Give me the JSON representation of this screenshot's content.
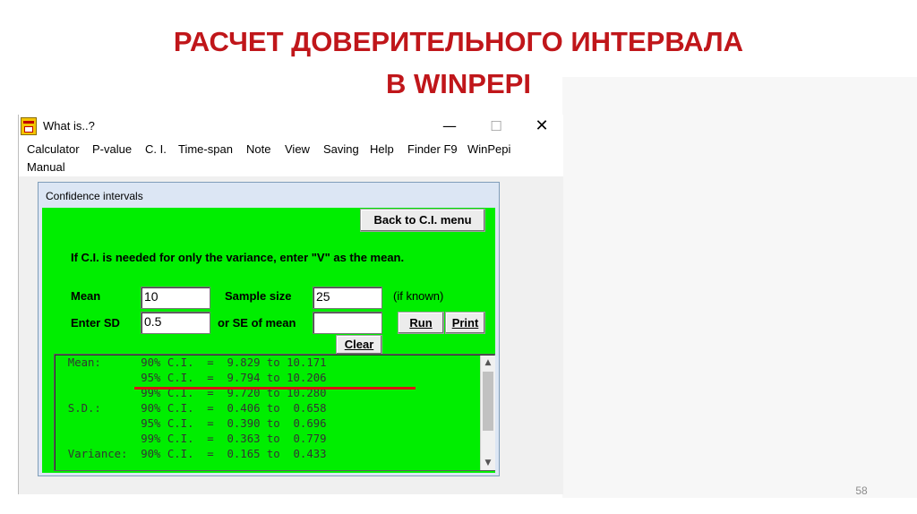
{
  "slide": {
    "title_line1": "РАСЧЕТ ДОВЕРИТЕЛЬНОГО ИНТЕРВАЛА",
    "title_line2": "В WINPEPI",
    "page_number": "58",
    "title_color": "#c0161a"
  },
  "window": {
    "title": "What is..?",
    "minimize_glyph": "—",
    "maximize_glyph": "☐",
    "close_glyph": "✕",
    "icon": "winpepi-app-icon"
  },
  "menu": {
    "items": [
      "Calculator",
      "P-value",
      "C. I.",
      "Time-span",
      "Note",
      "View",
      "Saving",
      "Help",
      "Finder F9",
      "WinPepi"
    ],
    "second_row": [
      "Manual"
    ]
  },
  "panel": {
    "title": "Confidence intervals",
    "back_button": "Back to C.I. menu",
    "instruction": "If C.I. is needed for only the variance, enter \"V\" as the mean.",
    "background_color": "#00ee00"
  },
  "form": {
    "mean_label": "Mean",
    "mean_value": "10",
    "sample_size_label": "Sample size",
    "sample_size_value": "25",
    "if_known_label": "(if known)",
    "sd_label": "Enter SD",
    "sd_value": "0.5",
    "se_label": "or SE of mean",
    "se_value": "",
    "run_button": "Run",
    "print_button": "Print",
    "clear_button": "Clear"
  },
  "results": {
    "lines": [
      "  Mean:      90% C.I.  =  9.829 to 10.171",
      "             95% C.I.  =  9.794 to 10.206",
      "             99% C.I.  =  9.720 to 10.280",
      "  S.D.:      90% C.I.  =  0.406 to  0.658",
      "             95% C.I.  =  0.390 to  0.696",
      "             99% C.I.  =  0.363 to  0.779",
      "  Variance:  90% C.I.  =  0.165 to  0.433"
    ],
    "highlight_color": "#d91414",
    "highlighted_line_index": 1
  }
}
